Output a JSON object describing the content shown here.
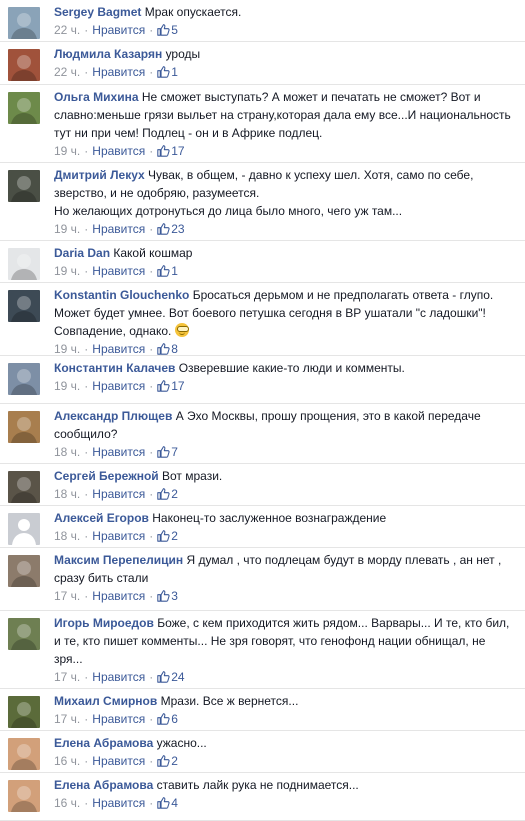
{
  "like_label": "Нравится",
  "separator": "·",
  "colors": {
    "link": "#3b5998",
    "meta": "#90949c",
    "text": "#141823"
  },
  "comments": [
    {
      "author": "Sergey Bagmet",
      "text": "Мрак опускается.",
      "time": "22 ч.",
      "likes": "5",
      "avatar_bg": "#8aa3b8"
    },
    {
      "author": "Людмила Казарян",
      "text": "уроды",
      "time": "22 ч.",
      "likes": "1",
      "avatar_bg": "#a0523b"
    },
    {
      "author": "Ольга Михина",
      "text": "Не сможет выступать? А может и печатать не сможет? Вот и славно:меньше грязи выльет на страну,которая дала ему все...И национальность тут ни при чем! Подлец - он и в Африке подлец.",
      "time": "19 ч.",
      "likes": "17",
      "avatar_bg": "#6d8a4a"
    },
    {
      "author": "Дмитрий Лекух",
      "text": "Чувак, в общем, - давно к успеху шел. Хотя, само по себе, зверство, и не одобряю, разумеется.\nНо желающих дотронуться до лица было много, чего уж там...",
      "time": "19 ч.",
      "likes": "23",
      "avatar_bg": "#4a4f45"
    },
    {
      "author": "Daria Dan",
      "text": "Какой кошмар",
      "time": "19 ч.",
      "likes": "1",
      "avatar_bg": "#e4e6e8"
    },
    {
      "author": "Konstantin Glouchenko",
      "text": "Бросаться дерьмом и не предполагать ответа - глупо. Может будет умнее. Вот боевого петушка сегодня в ВР ушатали \"с ладошки\"! Совпадение, однако.",
      "time": "19 ч.",
      "likes": "8",
      "avatar_bg": "#3d4a55",
      "emoji": "sunglasses-emoji"
    },
    {
      "author": "Константин Калачев",
      "text": "Озверевшие какие-то люди и комменты.",
      "time": "19 ч.",
      "likes": "17",
      "avatar_bg": "#7d8fa6"
    },
    {
      "author": "Александр Плющев",
      "text": "А Эхо Москвы, прошу прощения, это в какой передаче сообщило?",
      "time": "18 ч.",
      "likes": "7",
      "avatar_bg": "#a87e4e"
    },
    {
      "author": "Сергей Бережной",
      "text": "Вот мрази.",
      "time": "18 ч.",
      "likes": "2",
      "avatar_bg": "#5a5448"
    },
    {
      "author": "Алексей Егоров",
      "text": "Наконец-то заслуженное вознаграждение",
      "time": "18 ч.",
      "likes": "2",
      "avatar_bg": "#c9ccd2",
      "silhouette": true
    },
    {
      "author": "Максим Перепелицин",
      "text": "Я думал , что подлецам будут в морду плевать , ан нет , сразу бить стали",
      "time": "17 ч.",
      "likes": "3",
      "avatar_bg": "#8c7b6b"
    },
    {
      "author": "Игорь Мироедов",
      "text": "Боже, с кем приходится жить рядом... Варвары... И те, кто бил, и те, кто пишет комменты... Не зря говорят, что генофонд нации обнищал, не зря...",
      "time": "17 ч.",
      "likes": "24",
      "avatar_bg": "#6e7f52"
    },
    {
      "author": "Михаил Смирнов",
      "text": "Мрази. Все ж вернется...",
      "time": "17 ч.",
      "likes": "6",
      "avatar_bg": "#5b6b3a"
    },
    {
      "author": "Елена Абрамова",
      "text": "ужасно...",
      "time": "16 ч.",
      "likes": "2",
      "avatar_bg": "#d2a07a"
    },
    {
      "author": "Елена Абрамова",
      "text": "ставить лайк рука не поднимается...",
      "time": "16 ч.",
      "likes": "4",
      "avatar_bg": "#d2a07a"
    }
  ]
}
